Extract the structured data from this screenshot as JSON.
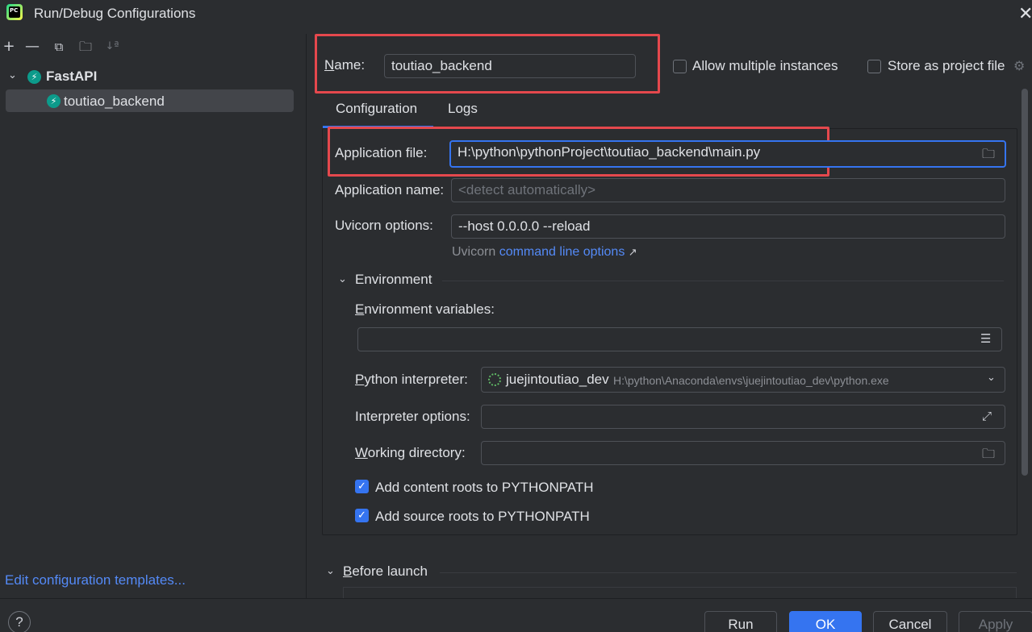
{
  "window": {
    "title": "Run/Debug Configurations",
    "app_icon_text": "PC",
    "close_glyph": "✕"
  },
  "toolbar": {
    "add": "+",
    "remove": "—",
    "copy": "⧉",
    "folder": "🗀",
    "sort": "↓ª"
  },
  "tree": {
    "group_label": "FastAPI",
    "group_icon": "⚡",
    "items": [
      {
        "label": "toutiao_backend",
        "icon": "⚡"
      }
    ]
  },
  "edit_templates_link": "Edit configuration templates...",
  "name_field": {
    "label": "Name:",
    "value": "toutiao_backend"
  },
  "allow_multiple": {
    "label": "Allow multiple instances",
    "checked": false
  },
  "store_project": {
    "label": "Store as project file",
    "checked": false
  },
  "tabs": [
    {
      "label": "Configuration",
      "active": true
    },
    {
      "label": "Logs",
      "active": false
    }
  ],
  "application_file": {
    "label": "Application file:",
    "value": "H:\\python\\pythonProject\\toutiao_backend\\main.py"
  },
  "application_name": {
    "label": "Application name:",
    "placeholder": "<detect automatically>"
  },
  "uvicorn_options": {
    "label": "Uvicorn options:",
    "value": "--host 0.0.0.0 --reload"
  },
  "uvicorn_hint": {
    "prefix": "Uvicorn",
    "link": "command line options",
    "arrow": "↗"
  },
  "environment": {
    "section_label": "Environment",
    "env_vars_label": "Environment variables:",
    "env_vars_value": "",
    "interpreter_label": "Python interpreter:",
    "interpreter_name": "juejintoutiao_dev",
    "interpreter_path": "H:\\python\\Anaconda\\envs\\juejintoutiao_dev\\python.exe",
    "interpreter_options_label": "Interpreter options:",
    "working_dir_label": "Working directory:",
    "content_roots": {
      "label": "Add content roots to PYTHONPATH",
      "checked": true
    },
    "source_roots": {
      "label": "Add source roots to PYTHONPATH",
      "checked": true
    }
  },
  "before_launch": {
    "label": "Before launch"
  },
  "buttons": {
    "help": "?",
    "run": "Run",
    "ok": "OK",
    "cancel": "Cancel",
    "apply": "Apply"
  },
  "colors": {
    "accent": "#3574f0",
    "highlight_box": "#e5484d",
    "background": "#2b2d30"
  }
}
